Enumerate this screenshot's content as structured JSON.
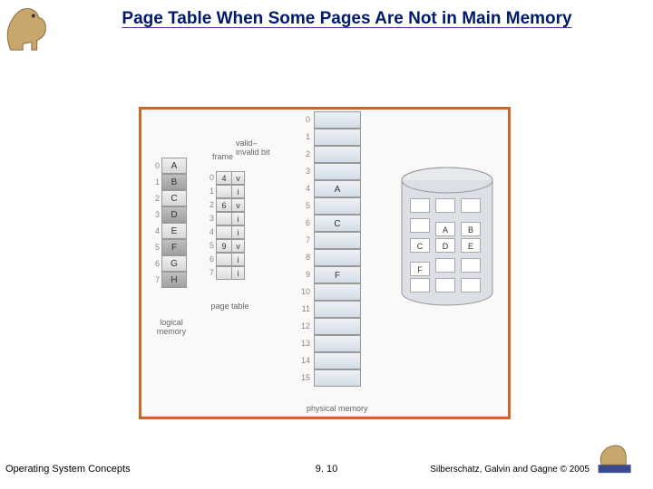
{
  "title": "Page Table When Some Pages Are Not in Main Memory",
  "footer": {
    "left": "Operating System Concepts",
    "center": "9. 10",
    "right": "Silberschatz, Galvin and Gagne © 2005"
  },
  "labels": {
    "logical_memory": "logical memory",
    "page_table": "page table",
    "physical_memory": "physical memory",
    "frame": "frame",
    "valid_invalid_bit": "valid–invalid bit"
  },
  "logical_memory": [
    {
      "idx": "0",
      "page": "A",
      "shaded": false
    },
    {
      "idx": "1",
      "page": "B",
      "shaded": true
    },
    {
      "idx": "2",
      "page": "C",
      "shaded": false
    },
    {
      "idx": "3",
      "page": "D",
      "shaded": true
    },
    {
      "idx": "4",
      "page": "E",
      "shaded": false
    },
    {
      "idx": "5",
      "page": "F",
      "shaded": true
    },
    {
      "idx": "6",
      "page": "G",
      "shaded": false
    },
    {
      "idx": "7",
      "page": "H",
      "shaded": true
    }
  ],
  "page_table": [
    {
      "idx": "0",
      "frame": "4",
      "bit": "v"
    },
    {
      "idx": "1",
      "frame": "",
      "bit": "i"
    },
    {
      "idx": "2",
      "frame": "6",
      "bit": "v"
    },
    {
      "idx": "3",
      "frame": "",
      "bit": "i"
    },
    {
      "idx": "4",
      "frame": "",
      "bit": "i"
    },
    {
      "idx": "5",
      "frame": "9",
      "bit": "v"
    },
    {
      "idx": "6",
      "frame": "",
      "bit": "i"
    },
    {
      "idx": "7",
      "frame": "",
      "bit": "i"
    }
  ],
  "physical_memory": [
    {
      "idx": "0",
      "content": ""
    },
    {
      "idx": "1",
      "content": ""
    },
    {
      "idx": "2",
      "content": ""
    },
    {
      "idx": "3",
      "content": ""
    },
    {
      "idx": "4",
      "content": "A"
    },
    {
      "idx": "5",
      "content": ""
    },
    {
      "idx": "6",
      "content": "C"
    },
    {
      "idx": "7",
      "content": ""
    },
    {
      "idx": "8",
      "content": ""
    },
    {
      "idx": "9",
      "content": "F"
    },
    {
      "idx": "10",
      "content": ""
    },
    {
      "idx": "11",
      "content": ""
    },
    {
      "idx": "12",
      "content": ""
    },
    {
      "idx": "13",
      "content": ""
    },
    {
      "idx": "14",
      "content": ""
    },
    {
      "idx": "15",
      "content": ""
    }
  ],
  "disk": [
    [
      "",
      "",
      ""
    ],
    [
      "",
      "A",
      "B"
    ],
    [
      "C",
      "D",
      "E"
    ],
    [
      "F",
      "",
      ""
    ],
    [
      "",
      "",
      ""
    ]
  ]
}
